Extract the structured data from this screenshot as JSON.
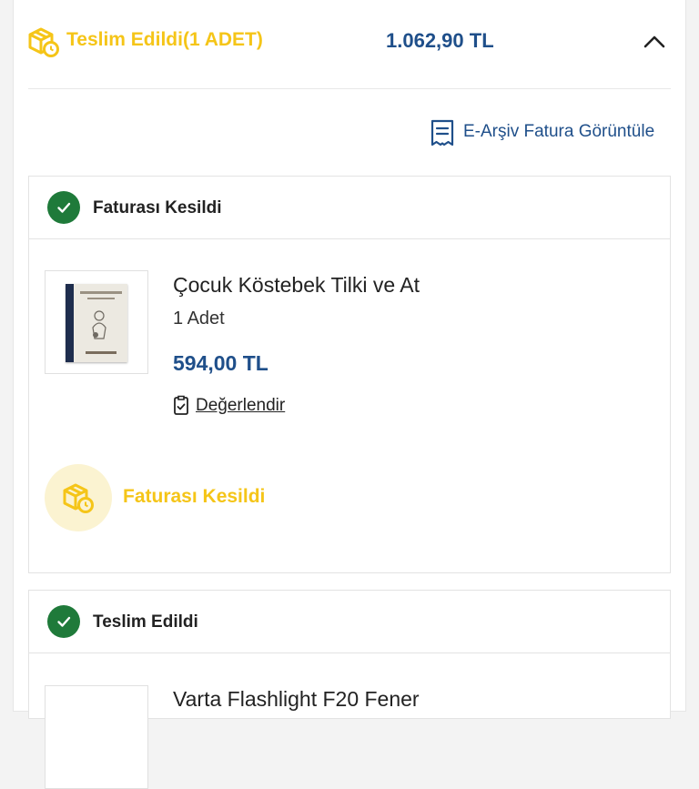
{
  "shipment": {
    "status_label": "Teslim Edildi(1 ADET)",
    "total": "1.062,90 TL"
  },
  "invoice_link": {
    "label": "E-Arşiv Fatura Görüntüle"
  },
  "package_1": {
    "header": "Faturası Kesildi",
    "product": {
      "name": "Çocuk Köstebek Tilki ve At",
      "quantity": "1 Adet",
      "price": "594,00 TL",
      "rate_label": "Değerlendir"
    },
    "status": "Faturası Kesildi"
  },
  "package_2": {
    "header": "Teslim Edildi",
    "product": {
      "name": "Varta Flashlight F20 Fener"
    }
  },
  "icons": {
    "box": "package-clock-icon",
    "chevron": "chevron-up-icon",
    "invoice": "receipt-icon",
    "check": "check-circle-icon",
    "rate": "clipboard-check-icon"
  },
  "colors": {
    "brand_yellow": "#f5c518",
    "brand_blue": "#1f4f8a",
    "success_green": "#1f7a3a"
  }
}
